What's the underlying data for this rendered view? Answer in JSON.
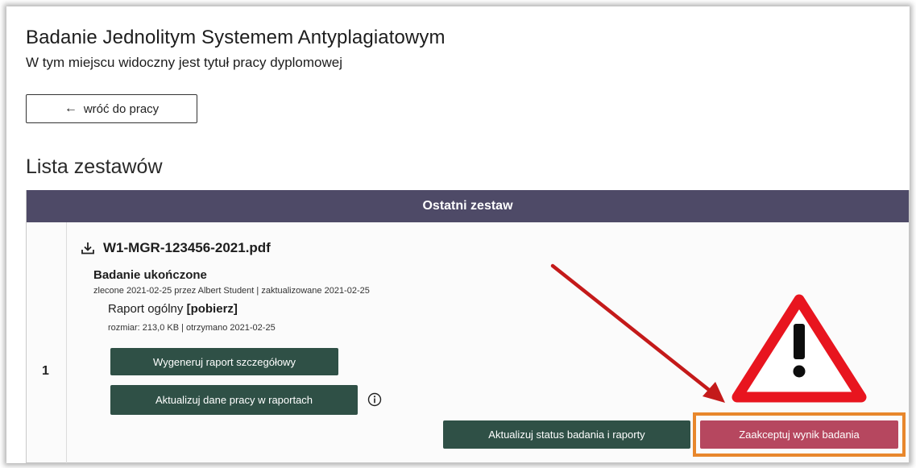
{
  "header": {
    "title": "Badanie Jednolitym Systemem Antyplagiatowym",
    "subtitle": "W tym miejscu widoczny jest tytuł pracy dyplomowej"
  },
  "back_button": {
    "arrow": "←",
    "label": "wróć do pracy",
    "icon": "arrow-left-icon"
  },
  "section": {
    "title": "Lista zestawów"
  },
  "table": {
    "header": "Ostatni zestaw",
    "rows": [
      {
        "number": "1",
        "file_name": "W1-MGR-123456-2021.pdf",
        "status": "Badanie ukończone",
        "meta": "zlecone 2021-02-25 przez Albert Student | zaktualizowane 2021-02-25",
        "report_label": "Raport ogólny",
        "report_link": "[pobierz]",
        "report_meta": "rozmiar: 213,0 KB | otrzymano 2021-02-25",
        "buttons": {
          "generate": "Wygeneruj raport szczegółowy",
          "update_data": "Aktualizuj dane pracy w raportach",
          "update_status": "Aktualizuj status badania i raporty",
          "accept": "Zaakceptuj wynik badania"
        }
      }
    ]
  },
  "icons": {
    "download": "download-icon",
    "info": "info-icon",
    "warning": "warning-triangle-icon",
    "pointer_arrow": "pointer-arrow-annotation"
  },
  "colors": {
    "header_bg": "#4e4a67",
    "button_dark": "#2f5046",
    "accept_button": "#b6475f",
    "highlight_border": "#e8872c",
    "annotation_red": "#c41a1a",
    "warning_red": "#e8151f"
  }
}
